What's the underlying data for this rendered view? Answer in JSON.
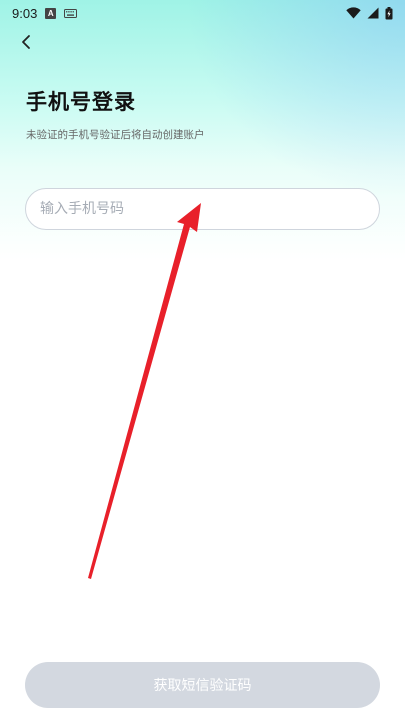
{
  "status_bar": {
    "time": "9:03",
    "input_indicator": "A",
    "icons": [
      "a-indicator-icon",
      "keyboard-icon",
      "wifi-icon",
      "signal-icon",
      "battery-icon"
    ]
  },
  "header": {
    "back_icon": "chevron-left-icon",
    "title": "手机号登录",
    "subtitle": "未验证的手机号验证后将自动创建账户"
  },
  "form": {
    "phone_placeholder": "输入手机号码",
    "phone_value": ""
  },
  "footer": {
    "get_code_label": "获取短信验证码",
    "enabled": false
  },
  "colors": {
    "accent_gradient_top": "#9ff3e6",
    "button_disabled": "#d3d8e0",
    "annotation_arrow": "#e8202a"
  }
}
